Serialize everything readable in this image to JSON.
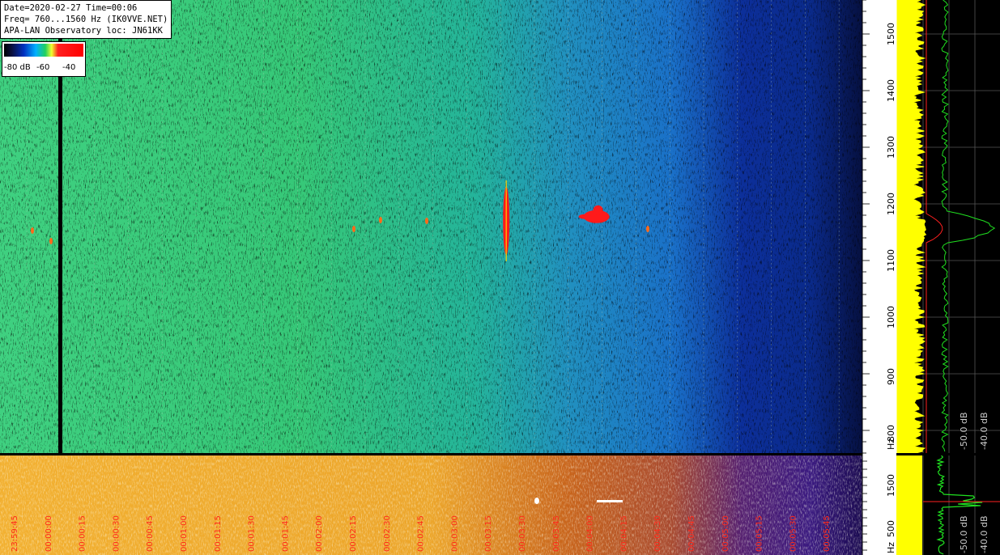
{
  "header": {
    "line1": "Date=2020-02-27 Time=00:06",
    "line2": "Freq= 760...1560 Hz (IK0VVE.NET)",
    "line3": "APA-LAN Observatory loc: JN61KK"
  },
  "color_scale": {
    "labels": [
      "-80 dB",
      "-60",
      "-40"
    ]
  },
  "colors": {
    "low": "#041a8a",
    "mid": "#2bd06a",
    "high": "#ff1a1a",
    "yellow_trace": "#ffff00",
    "green_trace": "#20ff20",
    "red_trace": "#ff2020",
    "bottom_base": "#e89a20",
    "bottom_dark": "#3a2080"
  },
  "chart_data": [
    {
      "type": "heatmap",
      "panel": "spectrogram",
      "ylabel": "Hz",
      "ylim": [
        760,
        1560
      ],
      "y_ticks": [
        800,
        900,
        1000,
        1100,
        1200,
        1300,
        1400,
        1500
      ],
      "x_ticks": [
        "23:59:45",
        "00:00:00",
        "00:00:15",
        "00:00:30",
        "00:00:45",
        "00:01:00",
        "00:01:15",
        "00:01:30",
        "00:01:45",
        "00:02:00",
        "00:02:15",
        "00:02:30",
        "00:02:45",
        "00:03:00",
        "00:03:15",
        "00:03:30",
        "00:03:45",
        "00:04:00",
        "00:04:15",
        "00:04:30",
        "00:04:45",
        "00:05:00",
        "00:05:15",
        "00:05:30",
        "00:05:45"
      ],
      "events": [
        {
          "time": "00:03:36",
          "freq_start": 1110,
          "freq_end": 1230,
          "level_db": -40
        },
        {
          "time": "00:04:00",
          "freq_start": 1165,
          "freq_end": 1190,
          "level_db": -40
        }
      ]
    },
    {
      "type": "line",
      "panel": "spectrum",
      "x_ticks": [
        "-50.0 dB",
        "-40.0 dB"
      ]
    },
    {
      "type": "heatmap",
      "panel": "power",
      "ylabel": "Hz",
      "y_ticks": [
        500,
        1500
      ]
    },
    {
      "type": "line",
      "panel": "power-spectrum",
      "x_ticks": [
        "-50.0 dB",
        "-40.0 dB"
      ]
    }
  ]
}
